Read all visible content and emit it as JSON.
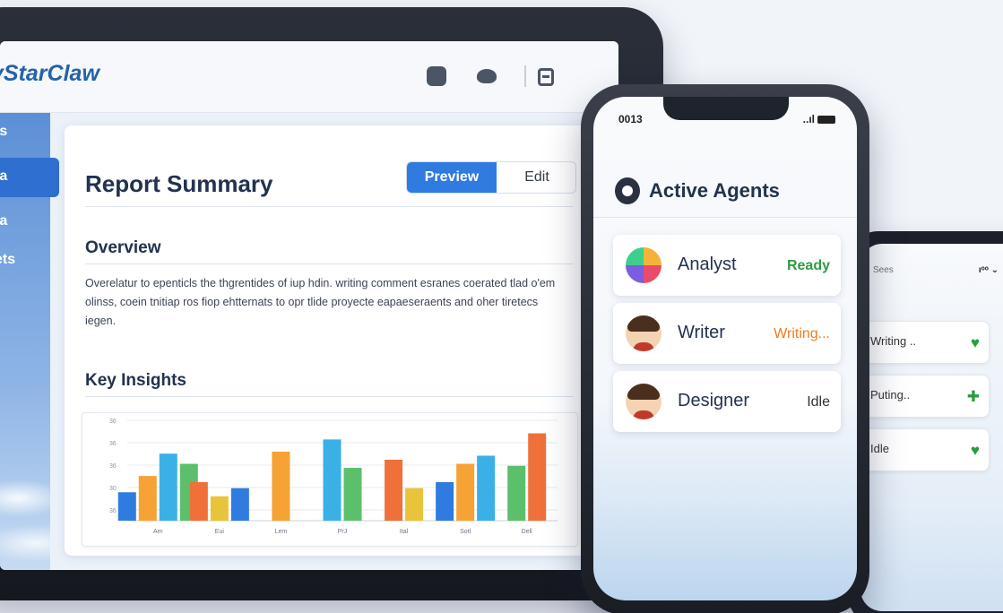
{
  "tablet": {
    "brand": "yStarClaw",
    "sidebar": [
      {
        "label": "ts"
      },
      {
        "label": "ta",
        "active": true
      },
      {
        "label": "ta"
      },
      {
        "label": "ets"
      }
    ],
    "report": {
      "title": "Report Summary",
      "preview_label": "Preview",
      "edit_label": "Edit",
      "overview_heading": "Overview",
      "overview_text": "Overelatur to epenticls the thgrentides of iup hdin. writing comment esranes coerated tlad o'em olinss, coein tnitiap ros fiop ehtternats to opr tlide proyecte eapaeseraents and oher tiretecs iegen.",
      "insights_heading": "Key Insights"
    },
    "chart_data": {
      "type": "bar",
      "categories": [
        "Am",
        "Eui",
        "Lem",
        "PrJ",
        "Ital",
        "Sotl",
        "Dell"
      ],
      "y_ticks": [
        "36",
        "30",
        "36",
        "36",
        "36"
      ],
      "groups": [
        {
          "category": "Am",
          "values": [
            14,
            22,
            33,
            28
          ]
        },
        {
          "category": "Eui",
          "values": [
            19,
            12,
            16
          ]
        },
        {
          "category": "Lem",
          "values": [
            34
          ]
        },
        {
          "category": "PrJ",
          "values": [
            40,
            26
          ]
        },
        {
          "category": "Ital",
          "values": [
            30,
            16
          ]
        },
        {
          "category": "Sotl",
          "values": [
            19,
            28,
            32
          ]
        },
        {
          "category": "Dell",
          "values": [
            27,
            43
          ]
        }
      ],
      "bar_colors": [
        "#2f7be0",
        "#f7a234",
        "#3ab0e6",
        "#5bbf6b",
        "#f0703a",
        "#e8c43a"
      ]
    }
  },
  "phone_main": {
    "time": "0013",
    "signal": "..ıl",
    "title": "Active Agents",
    "agents": [
      {
        "name": "Analyst",
        "status": "Ready"
      },
      {
        "name": "Writer",
        "status": "Writing..."
      },
      {
        "name": "Designer",
        "status": "Idle"
      }
    ]
  },
  "phone_back": {
    "status_left": "Sees",
    "status_right": "ıᵒᵒ ⌄",
    "rows": [
      {
        "label": "Writing ..",
        "icon": "heart-icon",
        "glyph": "♥"
      },
      {
        "label": "Puting..",
        "icon": "puzzle-icon",
        "glyph": "✚"
      },
      {
        "label": "Idle",
        "icon": "heart-icon",
        "glyph": "♥"
      }
    ]
  }
}
